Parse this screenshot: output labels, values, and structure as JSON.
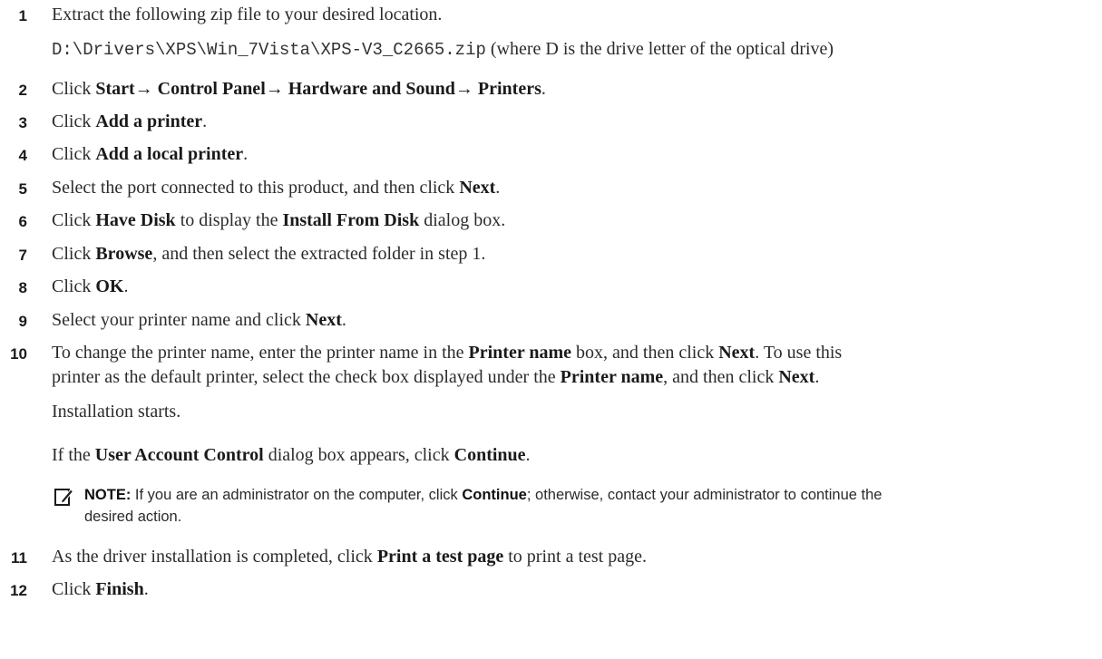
{
  "steps": [
    {
      "num": "1",
      "text": "Extract the following zip file to your desired location."
    },
    {
      "num": "2",
      "t1": "Click ",
      "b1": "Start",
      "a1": "→ ",
      "b2": "Control Panel",
      "a2": "→ ",
      "b3": "Hardware and Sound",
      "a3": "→ ",
      "b4": "Printers",
      "t2": "."
    },
    {
      "num": "3",
      "t1": "Click ",
      "b1": "Add a printer",
      "t2": "."
    },
    {
      "num": "4",
      "t1": "Click ",
      "b1": "Add a local printer",
      "t2": "."
    },
    {
      "num": "5",
      "t1": "Select the port connected to this product, and then click ",
      "b1": "Next",
      "t2": "."
    },
    {
      "num": "6",
      "t1": "Click ",
      "b1": "Have Disk",
      "t2": " to display the ",
      "b2": "Install From Disk",
      "t3": " dialog box."
    },
    {
      "num": "7",
      "t1": "Click ",
      "b1": "Browse",
      "t2": ", and then select the extracted folder in step 1."
    },
    {
      "num": "8",
      "t1": "Click ",
      "b1": "OK",
      "t2": "."
    },
    {
      "num": "9",
      "t1": "Select your printer name and click ",
      "b1": "Next",
      "t2": "."
    },
    {
      "num": "10",
      "t1": "To change the printer name, enter the printer name in the ",
      "b1": "Printer name",
      "t2": " box, and then click ",
      "b2": "Next",
      "t3": ". To use this",
      "t4": "printer as the default printer, select the check box displayed under the ",
      "b3": "Printer name",
      "t5": ", and then click ",
      "b4": "Next",
      "t6": "."
    },
    {
      "num": "11",
      "t1": "As the driver installation is completed, click ",
      "b1": "Print a test page",
      "t2": " to print a test page."
    },
    {
      "num": "12",
      "t1": "Click ",
      "b1": "Finish",
      "t2": "."
    }
  ],
  "path": {
    "code": "D:\\Drivers\\XPS\\Win_7Vista\\XPS-V3_C2665.zip",
    "suffix": " (where D is the drive letter of the optical drive)"
  },
  "installation_starts": "Installation starts.",
  "uac": {
    "t1": "If the ",
    "b1": "User Account Control",
    "t2": " dialog box appears, click ",
    "b2": "Continue",
    "t3": "."
  },
  "note": {
    "label": "NOTE:",
    "t1": " If you are an administrator on the computer, click ",
    "b1": "Continue",
    "t2": "; otherwise, contact your administrator to continue the",
    "line2": "desired action.",
    "icon": "pencil-note-icon"
  }
}
